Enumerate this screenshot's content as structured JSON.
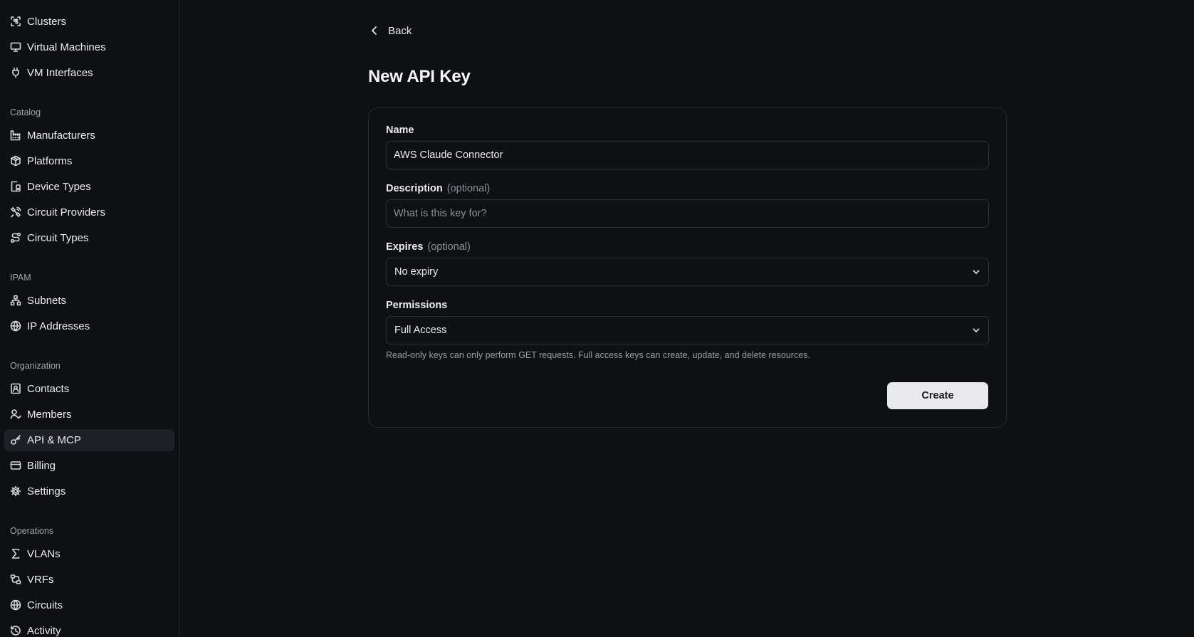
{
  "sidebar": {
    "items_top": [
      {
        "label": "Clusters",
        "icon": "cluster-icon"
      },
      {
        "label": "Virtual Machines",
        "icon": "monitor-icon"
      },
      {
        "label": "VM Interfaces",
        "icon": "plug-icon"
      }
    ],
    "sections": [
      {
        "title": "Catalog",
        "items": [
          {
            "label": "Manufacturers",
            "icon": "factory-icon"
          },
          {
            "label": "Platforms",
            "icon": "package-icon"
          },
          {
            "label": "Device Types",
            "icon": "device-icon"
          },
          {
            "label": "Circuit Providers",
            "icon": "satellite-icon"
          },
          {
            "label": "Circuit Types",
            "icon": "route-icon"
          }
        ]
      },
      {
        "title": "IPAM",
        "items": [
          {
            "label": "Subnets",
            "icon": "network-icon"
          },
          {
            "label": "IP Addresses",
            "icon": "globe-icon"
          }
        ]
      },
      {
        "title": "Organization",
        "items": [
          {
            "label": "Contacts",
            "icon": "contact-icon"
          },
          {
            "label": "Members",
            "icon": "user-check-icon"
          },
          {
            "label": "API & MCP",
            "icon": "key-icon",
            "active": true
          },
          {
            "label": "Billing",
            "icon": "credit-card-icon"
          },
          {
            "label": "Settings",
            "icon": "gear-icon"
          }
        ]
      },
      {
        "title": "Operations",
        "items": [
          {
            "label": "VLANs",
            "icon": "sigma-icon"
          },
          {
            "label": "VRFs",
            "icon": "split-icon"
          },
          {
            "label": "Circuits",
            "icon": "globe-icon"
          },
          {
            "label": "Activity",
            "icon": "history-icon"
          }
        ]
      }
    ]
  },
  "main": {
    "back_label": "Back",
    "title": "New API Key",
    "form": {
      "name_label": "Name",
      "name_value": "AWS Claude Connector",
      "description_label": "Description",
      "description_optional": "(optional)",
      "description_placeholder": "What is this key for?",
      "expires_label": "Expires",
      "expires_optional": "(optional)",
      "expires_value": "No expiry",
      "permissions_label": "Permissions",
      "permissions_value": "Full Access",
      "permissions_help": "Read-only keys can only perform GET requests. Full access keys can create, update, and delete resources.",
      "create_label": "Create"
    }
  }
}
